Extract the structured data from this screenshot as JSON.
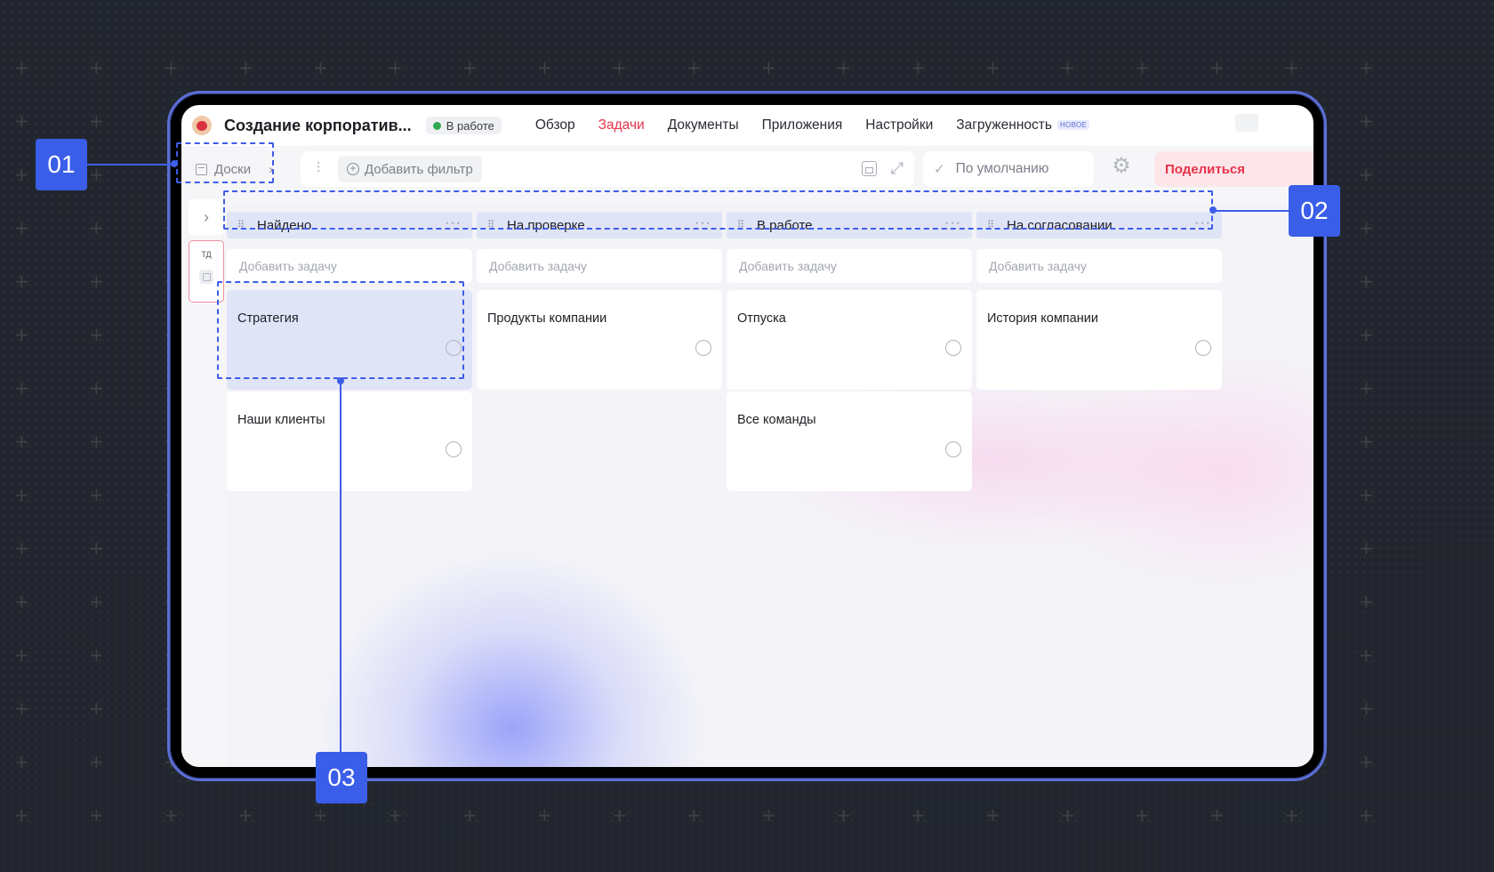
{
  "app": {
    "project_title": "Создание корпоратив...",
    "status_label": "В работе",
    "nav": [
      {
        "label": "Обзор",
        "active": false
      },
      {
        "label": "Задачи",
        "active": true
      },
      {
        "label": "Документы",
        "active": false
      },
      {
        "label": "Приложения",
        "active": false
      },
      {
        "label": "Настройки",
        "active": false
      },
      {
        "label": "Загруженность",
        "active": false,
        "badge": "НОВОЕ"
      }
    ]
  },
  "toolbar": {
    "boards_label": "Доски",
    "add_filter_label": "Добавить фильтр",
    "view_label": "По умолчанию",
    "share_label": "Поделиться"
  },
  "sidebar": {
    "mini_label": "ТД"
  },
  "board": {
    "add_task_placeholder": "Добавить задачу",
    "columns": [
      {
        "title": "Найдено",
        "cards": [
          "Стратегия",
          "Наши клиенты"
        ]
      },
      {
        "title": "На проверке",
        "cards": [
          "Продукты компании"
        ]
      },
      {
        "title": "В работе",
        "cards": [
          "Отпуска",
          "Все команды"
        ]
      },
      {
        "title": "На согласовании",
        "cards": [
          "История компании"
        ]
      }
    ]
  },
  "callouts": [
    "01",
    "02",
    "03"
  ],
  "colors": {
    "accent": "#3a5ee8",
    "active_nav": "#e5334b",
    "status_dot": "#2fa84f",
    "selected_card": "#dfe4f7"
  }
}
